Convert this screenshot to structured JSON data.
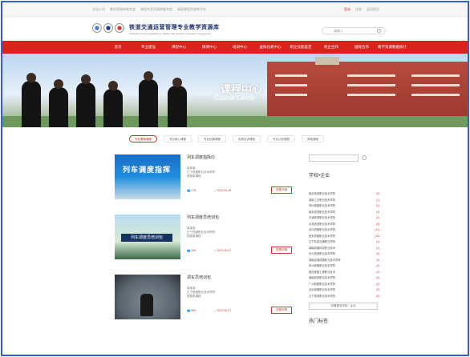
{
  "topbar": {
    "links": [
      "文化公司",
      "教学资源库联合会",
      "课程共享资源库联合会",
      "高职课程资源库平台"
    ],
    "login": "登录",
    "register": "注册",
    "help": "返回首页"
  },
  "header": {
    "title": "铁道交通运营管理专业教学资源库",
    "subtitle": "Teaching resource database of railway transportation operation management",
    "search_placeholder": "请输入..."
  },
  "nav": {
    "items": [
      "首页",
      "专业建设",
      "课程中心",
      "微课中心",
      "培训中心",
      "虚拟仿真中心",
      "职业技能鉴定",
      "校企合作",
      "国际合作",
      "教学资源数据统计"
    ]
  },
  "banner": {
    "title": "课程中心",
    "subtitle": "Course Center"
  },
  "tabs": [
    "专业基础课程",
    "专业核心课程",
    "专业拓展课程",
    "实践实训课程",
    "专业认知课程",
    "其他课程"
  ],
  "courses": [
    {
      "name": "列车调度指挥(I)",
      "thumb_text": "列车调度指挥",
      "teacher": "某某某",
      "school": "辽宁铁道职业技术学院",
      "type": "铁路类课程",
      "views": "178",
      "date": "2022-05-18",
      "button": "查看详情"
    },
    {
      "name": "列车调度员培训包",
      "thumb_text": "列车调度员培训包",
      "teacher": "某某某",
      "school": "辽宁铁道职业技术学院",
      "type": "铁路类课程",
      "views": "108",
      "date": "2022-06-07",
      "button": "查看详情"
    },
    {
      "name": "调车员培训包",
      "thumb_text": "",
      "teacher": "某某某",
      "school": "辽宁铁道职业技术学院",
      "type": "铁路类课程",
      "views": "889",
      "date": "2022-06-07",
      "button": "查看详情"
    }
  ],
  "sidebar": {
    "heading": "学校•企业",
    "schools": [
      {
        "name": "南京铁道职业技术学院",
        "count": "(2)"
      },
      {
        "name": "湖南工业职业技术学院",
        "count": "(1)"
      },
      {
        "name": "郑州铁路职业技术学院",
        "count": "(2)"
      },
      {
        "name": "南京铁道职业技术学院",
        "count": "(9)"
      },
      {
        "name": "天津铁道职业技术学院",
        "count": "(2)"
      },
      {
        "name": "吉林铁道职业技术学院",
        "count": "(6)"
      },
      {
        "name": "武汉铁路职业技术学院",
        "count": "(12)"
      },
      {
        "name": "西安铁路职业技术学院",
        "count": "(18)"
      },
      {
        "name": "辽宁轨道交通职业学院",
        "count": "(1)"
      },
      {
        "name": "湖南铁路科技职业技术",
        "count": "(1)"
      },
      {
        "name": "包头铁道职业技术学院",
        "count": "(3)"
      },
      {
        "name": "湖南高速铁路职业技术学院",
        "count": "(3)"
      },
      {
        "name": "贵州铁路职业技术学院",
        "count": "(2)"
      },
      {
        "name": "陕西铁路工程职业技术",
        "count": "(2)"
      },
      {
        "name": "湖南铁道职业技术学院",
        "count": "(3)"
      },
      {
        "name": "广州铁路职业技术学院",
        "count": "(2)"
      },
      {
        "name": "北京铁路职业技术学院",
        "count": "(2)"
      },
      {
        "name": "辽宁铁道职业技术学院",
        "count": "(5)"
      }
    ],
    "more_button": "查看更多学校 / 企业",
    "hot_heading": "热门标签"
  }
}
